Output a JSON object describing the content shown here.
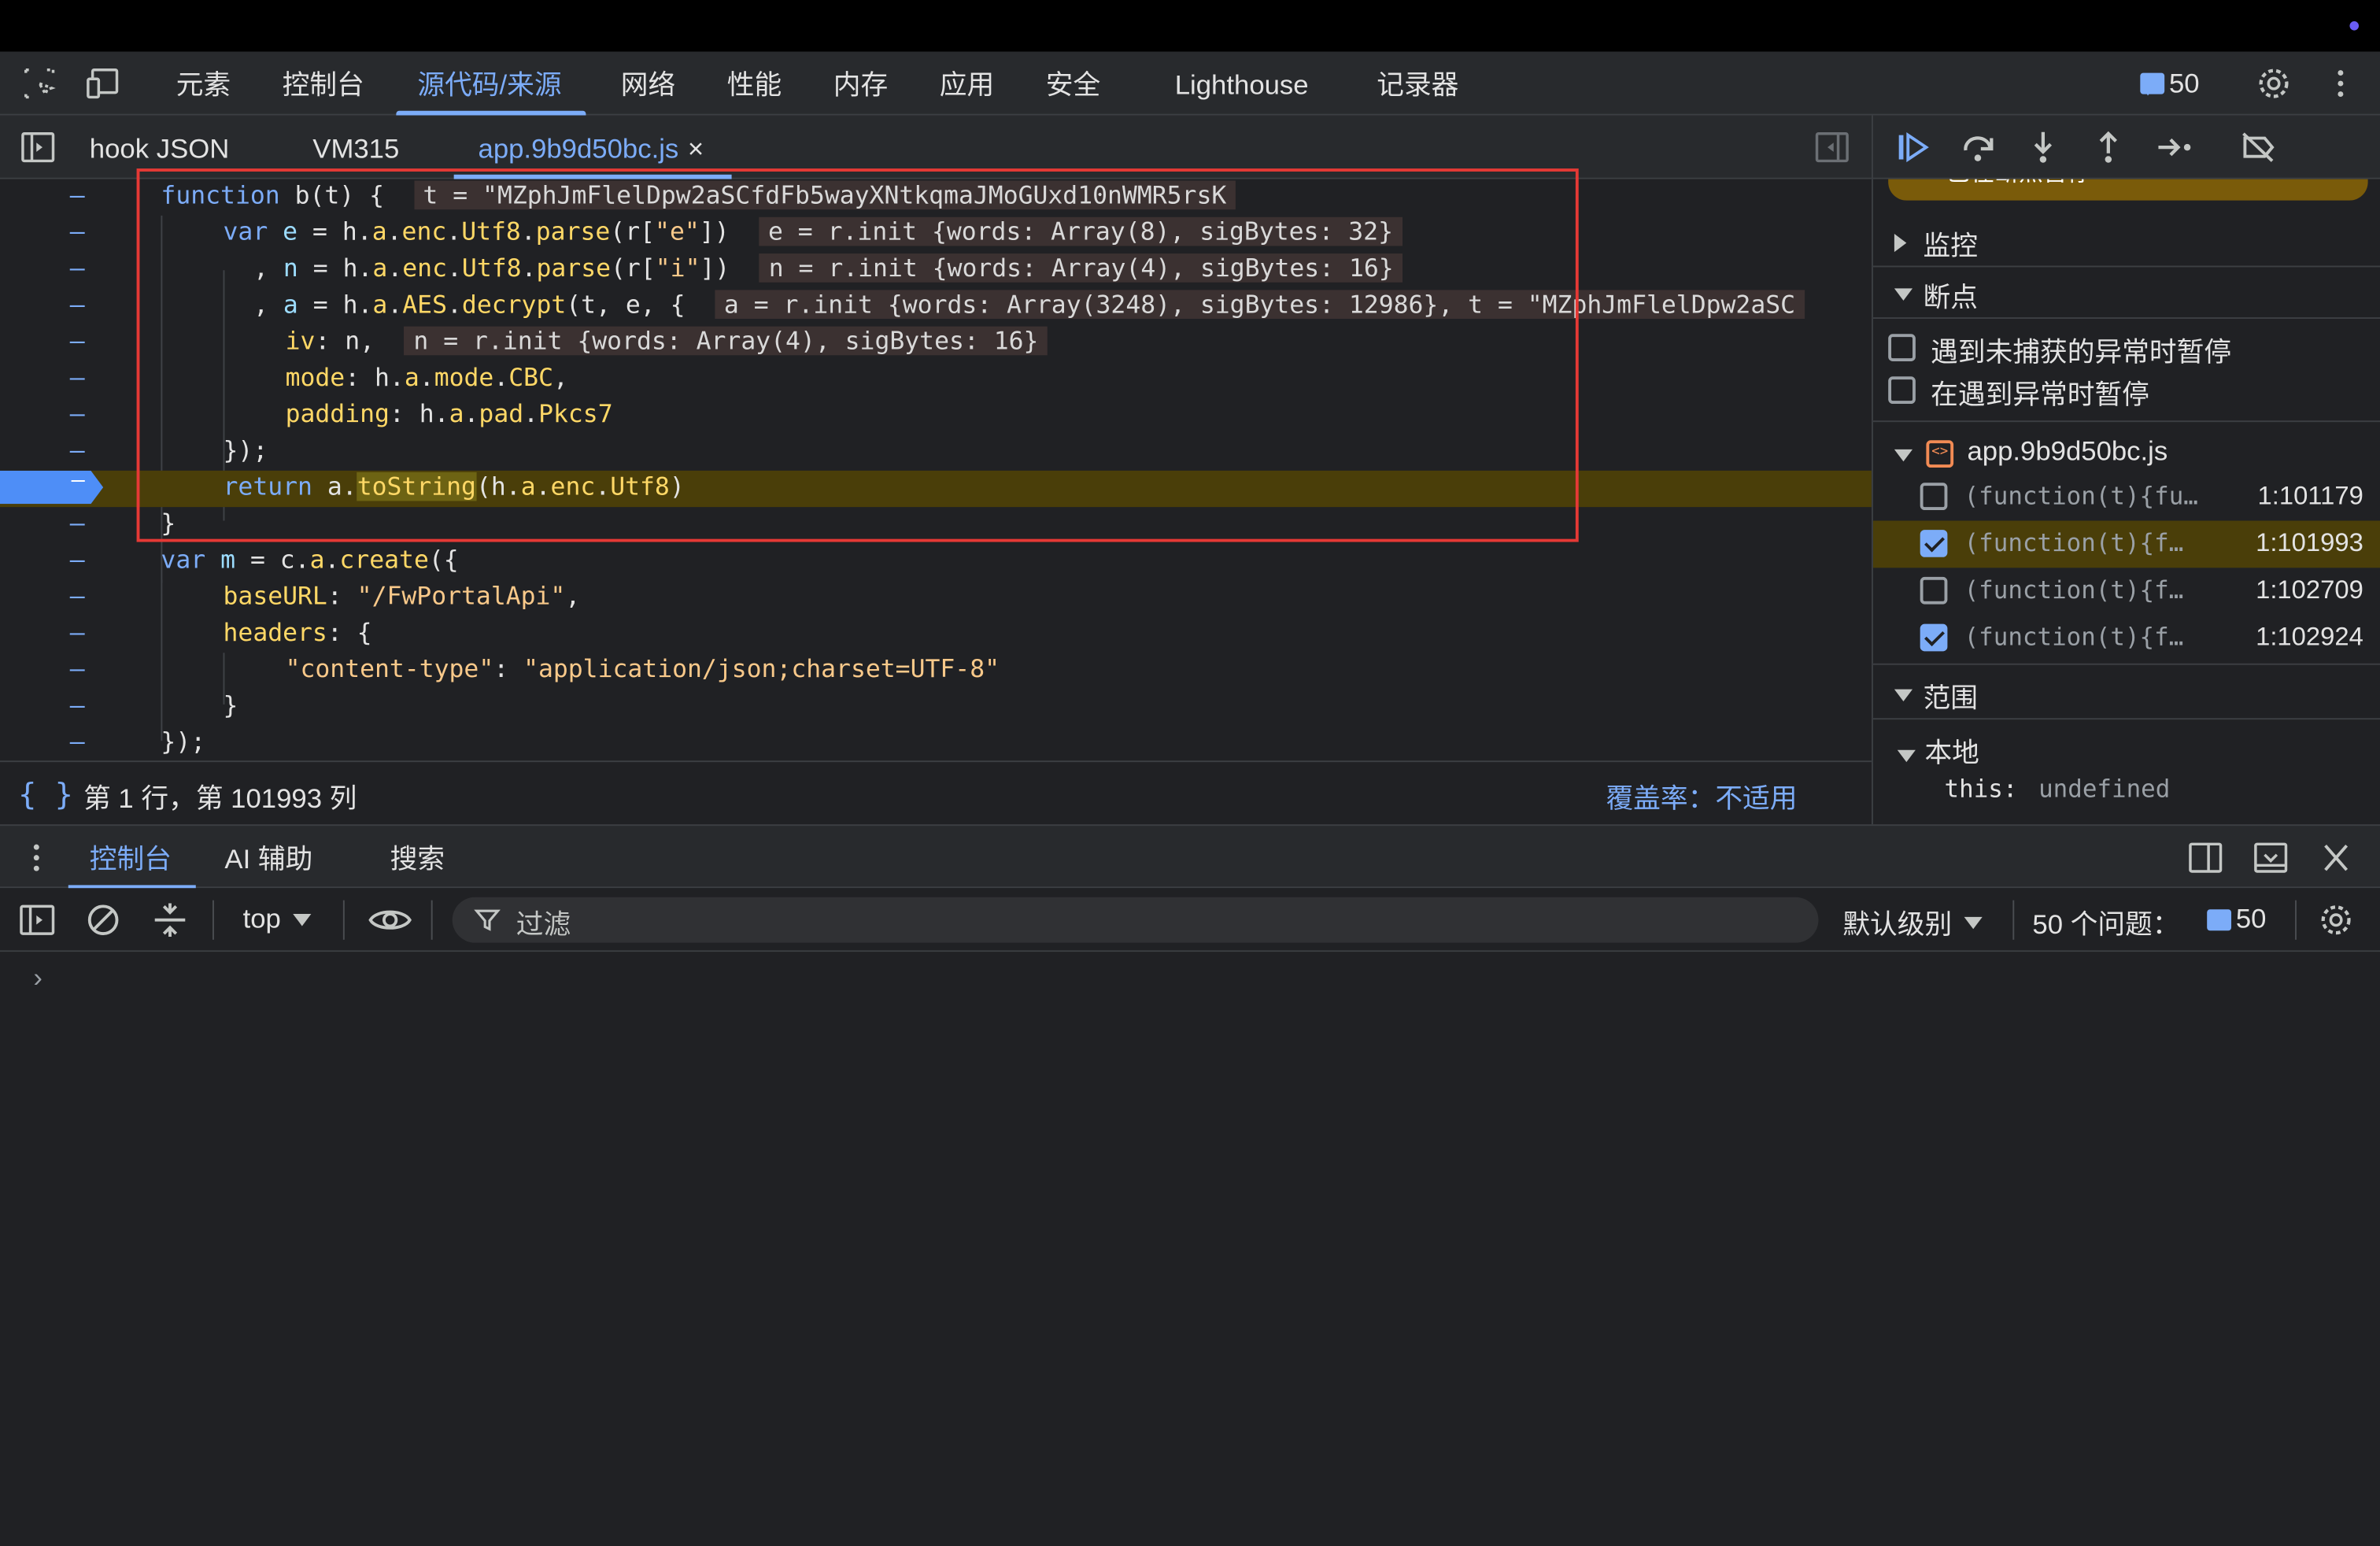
{
  "main_tabs": [
    "元素",
    "控制台",
    "源代码/来源",
    "网络",
    "性能",
    "内存",
    "应用",
    "安全",
    "Lighthouse",
    "记录器"
  ],
  "issues_count": "50",
  "file_tabs": [
    "hook JSON",
    "VM315",
    "app.9b9d50bc.js"
  ],
  "file_tab_close": "×",
  "code": {
    "l1_kw": "function",
    "l1_rest": " b(t) {",
    "l1_inline": "t = \"MZphJmFlelDpw2aSCfdFb5wayXNtkqmaJMoGUxd10nWMR5rsK",
    "l2_inline": "e = r.init {words: Array(8), sigBytes: 32}",
    "l3_inline": "n = r.init {words: Array(4), sigBytes: 16}",
    "l4_inline": "a = r.init {words: Array(3248), sigBytes: 12986}, t = \"MZphJmFlelDpw2aSC",
    "l5_inline": "n = r.init {words: Array(4), sigBytes: 16}",
    "baseURL": "\"/FwPortalApi\"",
    "content_type_key": "\"content-type\"",
    "content_type_val": "\"application/json;charset=UTF-8\""
  },
  "status": {
    "braces": "{ }",
    "position": "第 1 行，第 101993 列",
    "coverage": "覆盖率：不适用"
  },
  "sidebar": {
    "paused_banner": "已在断点暂停",
    "watch": "监控",
    "breakpoints": "断点",
    "opt_uncaught": "遇到未捕获的异常时暂停",
    "opt_caught": "在遇到异常时暂停",
    "file": "app.9b9d50bc.js",
    "bp_items": [
      {
        "code": "(function(t){fu…",
        "loc": "1:101179",
        "checked": false
      },
      {
        "code": "(function(t){f…",
        "loc": "1:101993",
        "checked": true
      },
      {
        "code": "(function(t){f…",
        "loc": "1:102709",
        "checked": false
      },
      {
        "code": "(function(t){f…",
        "loc": "1:102924",
        "checked": true
      }
    ],
    "scope": "范围",
    "local": "本地",
    "this_key": "this:",
    "this_val": "undefined"
  },
  "drawer": {
    "tabs": [
      "控制台",
      "AI 辅助",
      "搜索"
    ],
    "context": "top",
    "filter_placeholder": "过滤",
    "level": "默认级别",
    "issues_label": "50 个问题：",
    "issues_count": "50",
    "prompt": "›"
  },
  "colors": {
    "accent": "#7cacf8",
    "paused_line": "#4a3e09",
    "red_box": "#e53935"
  }
}
